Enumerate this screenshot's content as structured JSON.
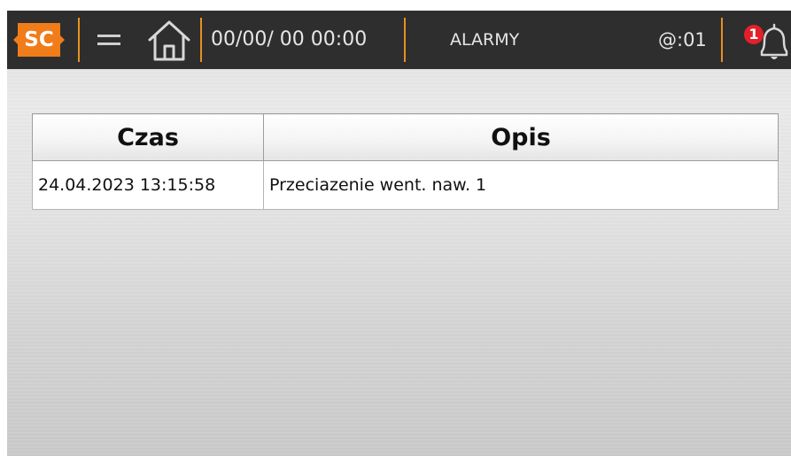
{
  "header": {
    "logo_text": "SC",
    "datetime": "00/00/ 00 00:00",
    "title": "ALARMY",
    "user": "@:01",
    "alarm_count": "1"
  },
  "icons": {
    "menu": "hamburger-menu-icon",
    "home": "home-icon",
    "bell": "bell-icon"
  },
  "colors": {
    "topbar": "#2e2e2e",
    "accent": "#f07d1a",
    "separator": "#e8901f",
    "badge": "#e3202a"
  },
  "table": {
    "columns": [
      "Czas",
      "Opis"
    ],
    "rows": [
      {
        "time": "24.04.2023 13:15:58",
        "description": "Przeciazenie went. naw. 1"
      }
    ]
  }
}
